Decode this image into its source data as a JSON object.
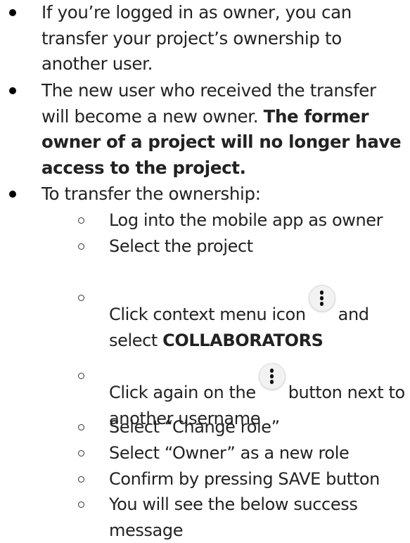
{
  "bullets": [
    {
      "text": "If you’re logged in as owner, you can transfer your project’s ownership to another user."
    },
    {
      "text": "The new user who received the transfer will become a new owner. ",
      "bold": "The former owner of a project will no longer have access to the project."
    },
    {
      "text": "To transfer the ownership:",
      "steps": [
        {
          "text": "Log into the mobile app as owner"
        },
        {
          "text": "Select the project"
        },
        {
          "before": "Click context menu icon",
          "icon": "context-menu-icon",
          "after": "and select ",
          "bold": "COLLABORATORS"
        },
        {
          "before": "Click again on the",
          "icon": "context-menu-icon",
          "after": "button next to another username"
        },
        {
          "text": "Select “Change role”"
        },
        {
          "text": "Select “Owner” as a new role"
        },
        {
          "text": "Confirm by pressing SAVE button"
        },
        {
          "text": "You will see the below success message"
        }
      ]
    }
  ]
}
